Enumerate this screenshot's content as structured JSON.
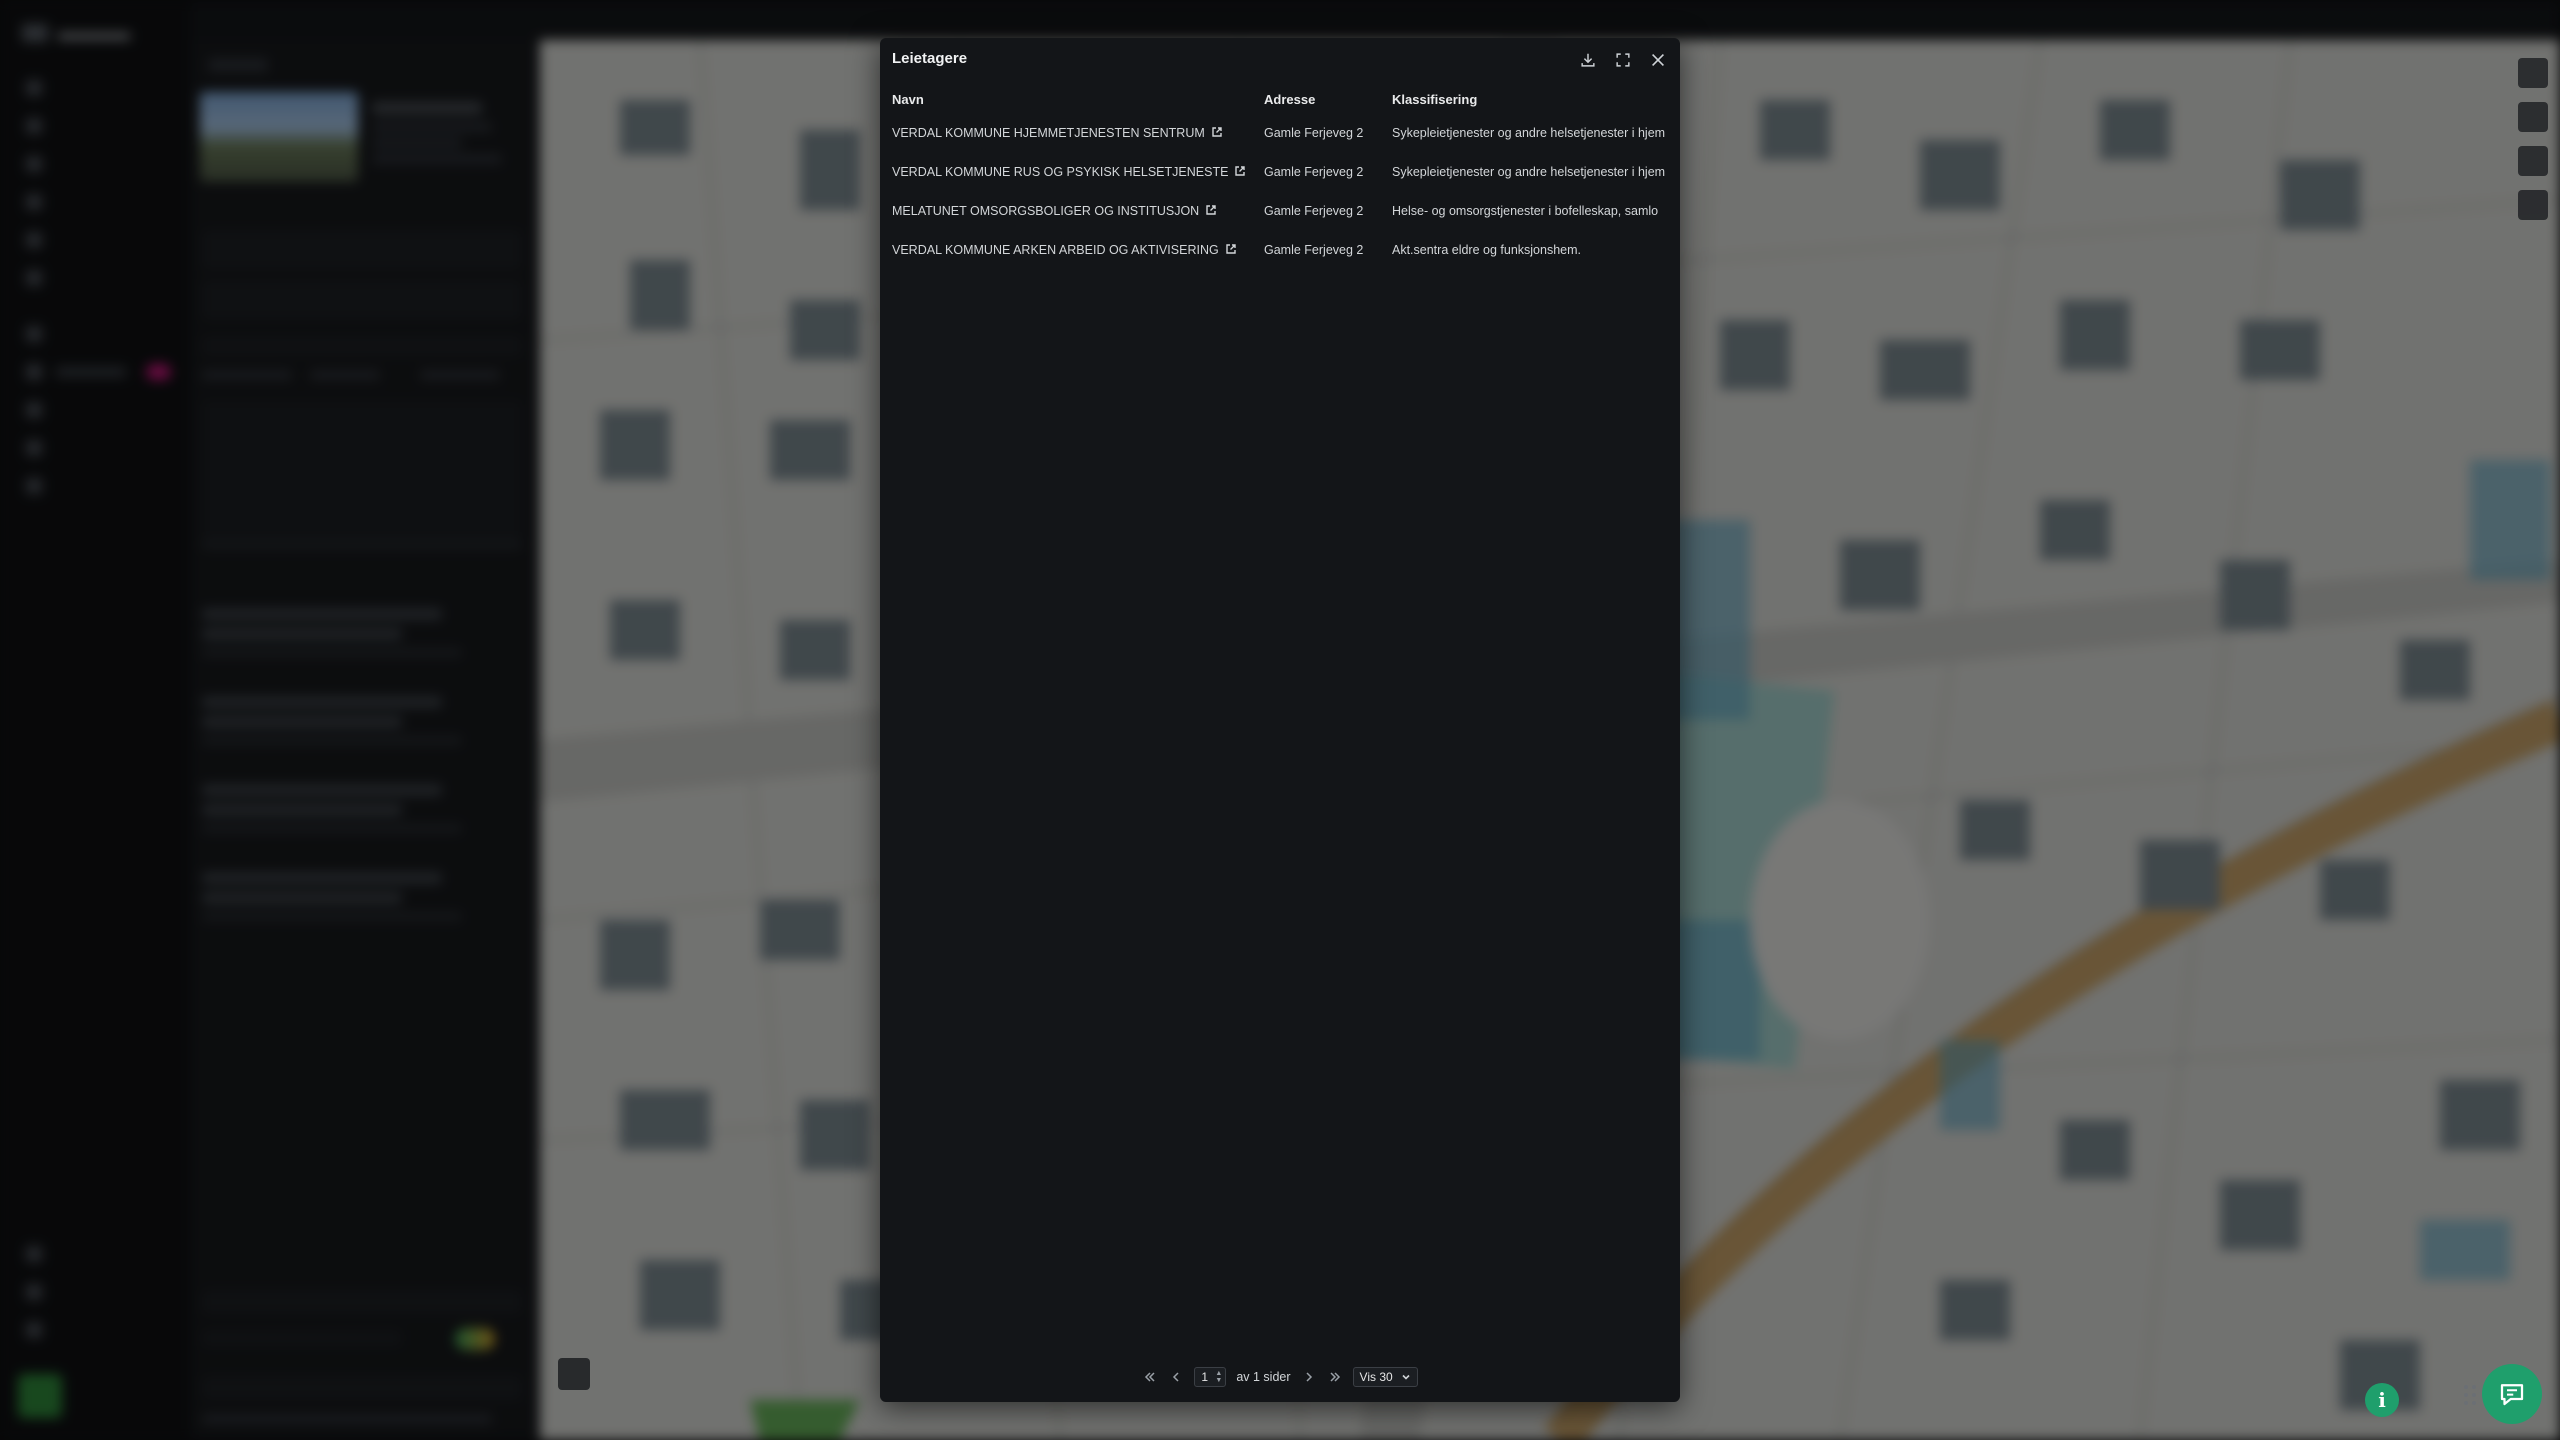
{
  "modal": {
    "title": "Leietagere",
    "icons": {
      "download": "download-icon",
      "expand": "expand-icon",
      "close": "close-icon"
    },
    "columns": [
      "Navn",
      "Adresse",
      "Klassifisering"
    ],
    "rows": [
      {
        "name": "VERDAL KOMMUNE HJEMMETJENESTEN SENTRUM",
        "address": "Gamle Ferjeveg 2",
        "classification": "Sykepleietjenester og andre helsetjenester i hjem"
      },
      {
        "name": "VERDAL KOMMUNE RUS OG PSYKISK HELSETJENESTE",
        "address": "Gamle Ferjeveg 2",
        "classification": "Sykepleietjenester og andre helsetjenester i hjem"
      },
      {
        "name": "MELATUNET OMSORGSBOLIGER OG INSTITUSJON",
        "address": "Gamle Ferjeveg 2",
        "classification": "Helse- og omsorgstjenester i bofelleskap, samlo"
      },
      {
        "name": "VERDAL KOMMUNE ARKEN ARBEID OG AKTIVISERING",
        "address": "Gamle Ferjeveg 2",
        "classification": "Akt.sentra eldre og funksjonshem."
      }
    ],
    "pagination": {
      "current_page": "1",
      "of_pages": "av 1 sider",
      "page_size": "Vis 30"
    }
  },
  "colors": {
    "accent": "#1f9f6c",
    "modal_bg": "#131518",
    "map_road": "#c9a46a",
    "map_water": "#5fa9c4"
  }
}
